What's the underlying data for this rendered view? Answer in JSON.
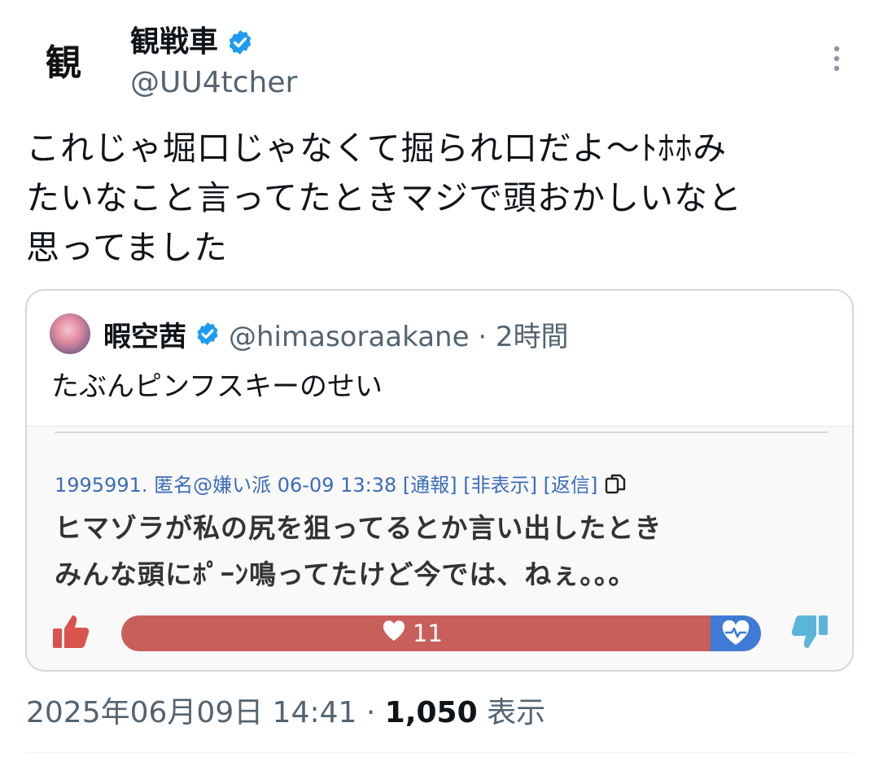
{
  "author": {
    "display_name": "観戦車",
    "handle": "@UU4tcher",
    "avatar_glyph": "観",
    "verified": true
  },
  "tweet": {
    "lines": [
      "これじゃ堀口じゃなくて掘られ口だよ〜ﾄﾎﾎみ",
      "たいなこと言ってたときマジで頭おかしいなと",
      "思ってました"
    ]
  },
  "quote": {
    "display_name": "暇空茜",
    "handle_time": "@himasoraakane · 2時間",
    "text": "たぶんピンフスキーのせい",
    "image": {
      "meta": "1995991. 匿名@嫌い派 06-09 13:38 [通報] [非表示] [返信]",
      "body_lines": [
        "ヒマゾラが私の尻を狙ってるとか言い出したとき",
        "みんな頭にﾎﾟｰﾝ鳴ってたけど今では、ねぇ。。。"
      ],
      "like_count": "11"
    }
  },
  "footer": {
    "timestamp": "2025年06月09日 14:41 · ",
    "views_count": "1,050",
    "views_label": " 表示"
  },
  "colors": {
    "verified": "#1d9bf0",
    "like_bar": "#c85f5a",
    "like_bar_end": "#3e7bd6",
    "meta_link": "#3b6cb8",
    "thumb_up": "#d9534f",
    "thumb_down": "#5bb5d8"
  },
  "icons": [
    "verified-badge-icon",
    "more-options-icon",
    "copy-icon",
    "thumbs-up-icon",
    "heart-icon",
    "heartbeat-icon",
    "thumbs-down-icon"
  ]
}
